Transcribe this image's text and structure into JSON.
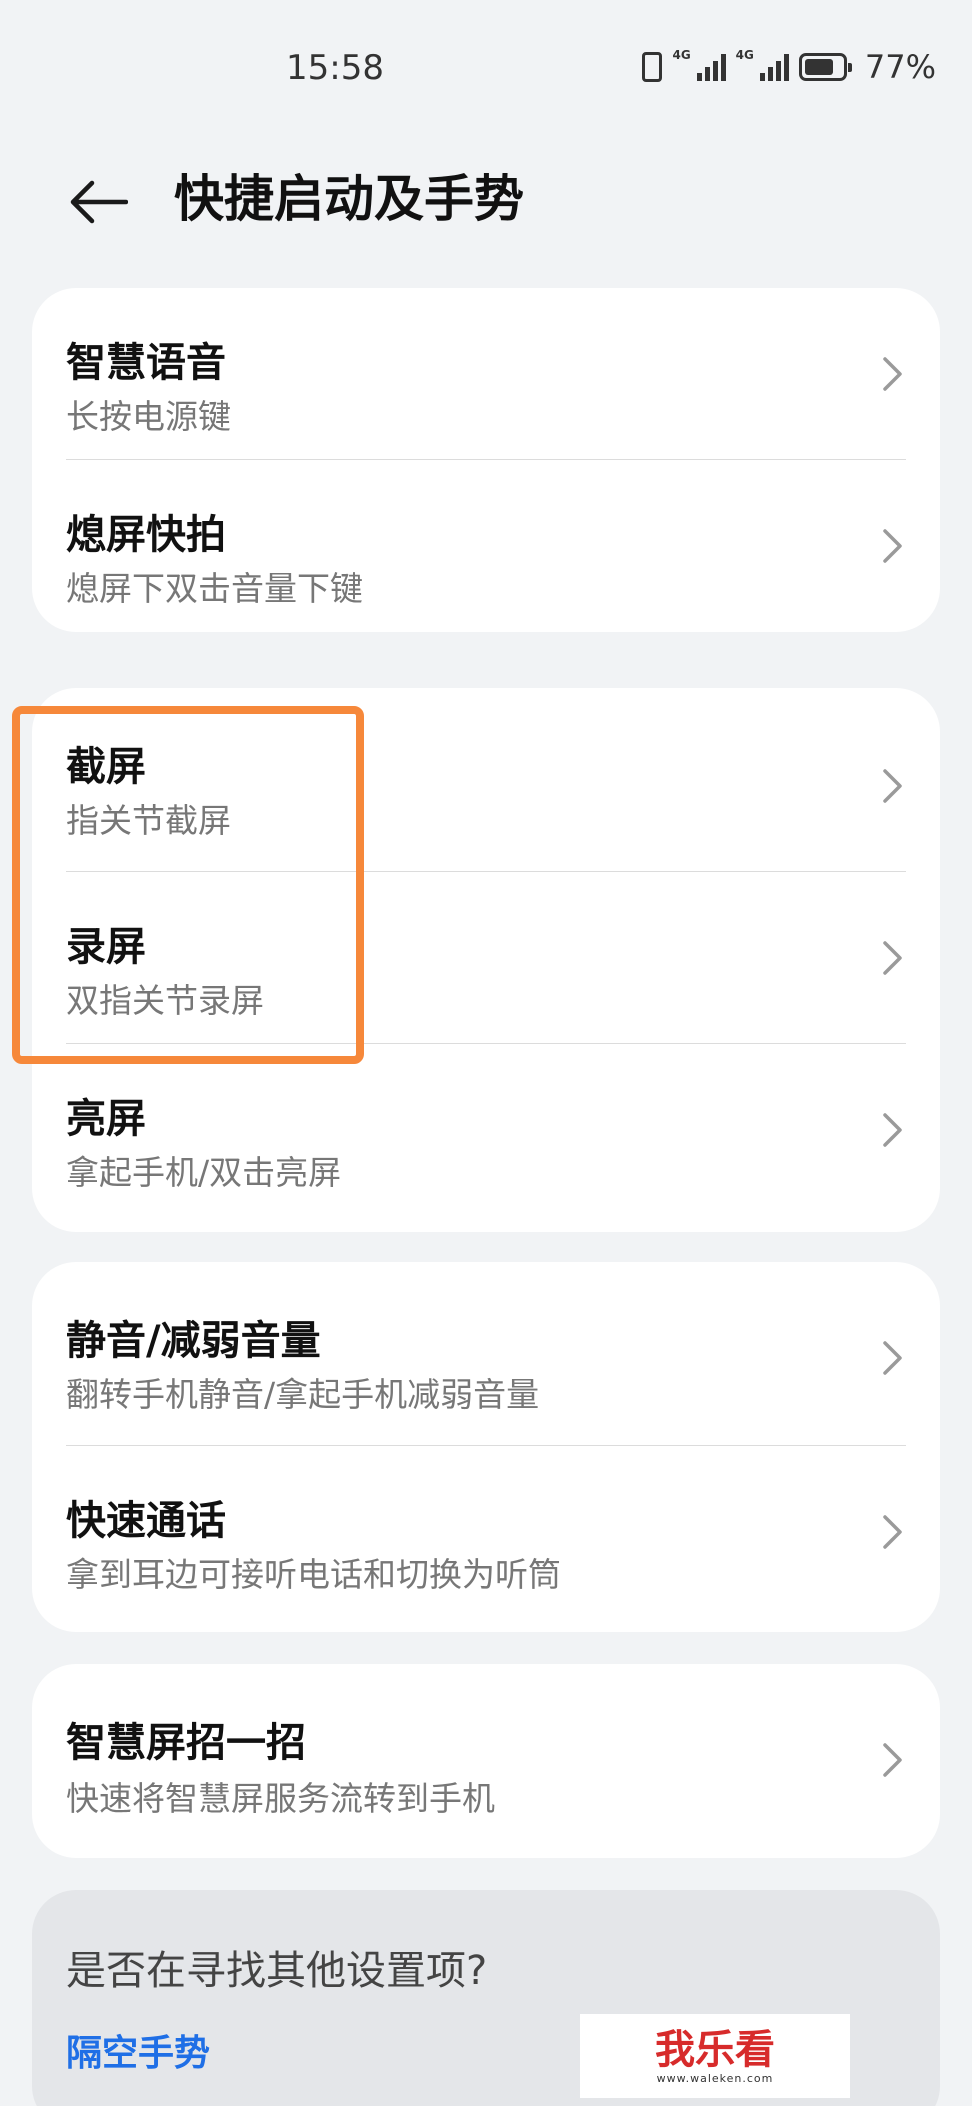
{
  "status": {
    "time": "15:58",
    "net1": "4G",
    "net2": "4G",
    "battery_text": "77%",
    "battery_level": 0.77
  },
  "header": {
    "title": "快捷启动及手势"
  },
  "cards": [
    {
      "rows": [
        {
          "title": "智慧语音",
          "subtitle": "长按电源键"
        },
        {
          "title": "熄屏快拍",
          "subtitle": "熄屏下双击音量下键"
        }
      ]
    },
    {
      "rows": [
        {
          "title": "截屏",
          "subtitle": "指关节截屏"
        },
        {
          "title": "录屏",
          "subtitle": "双指关节录屏"
        },
        {
          "title": "亮屏",
          "subtitle": "拿起手机/双击亮屏"
        }
      ]
    },
    {
      "rows": [
        {
          "title": "静音/减弱音量",
          "subtitle": "翻转手机静音/拿起手机减弱音量"
        },
        {
          "title": "快速通话",
          "subtitle": "拿到耳边可接听电话和切换为听筒"
        }
      ]
    },
    {
      "rows": [
        {
          "title": "智慧屏招一招",
          "subtitle": "快速将智慧屏服务流转到手机"
        }
      ]
    }
  ],
  "search": {
    "question": "是否在寻找其他设置项?",
    "link": "隔空手势"
  },
  "watermark": {
    "logo": "我乐看",
    "url": "www.waleken.com"
  },
  "colors": {
    "background": "#f1f3f5",
    "card": "#ffffff",
    "highlight": "#f6883a",
    "link": "#1f6fe6"
  },
  "icons": {
    "back": "arrow-left-icon",
    "chevron": "chevron-right-icon"
  }
}
